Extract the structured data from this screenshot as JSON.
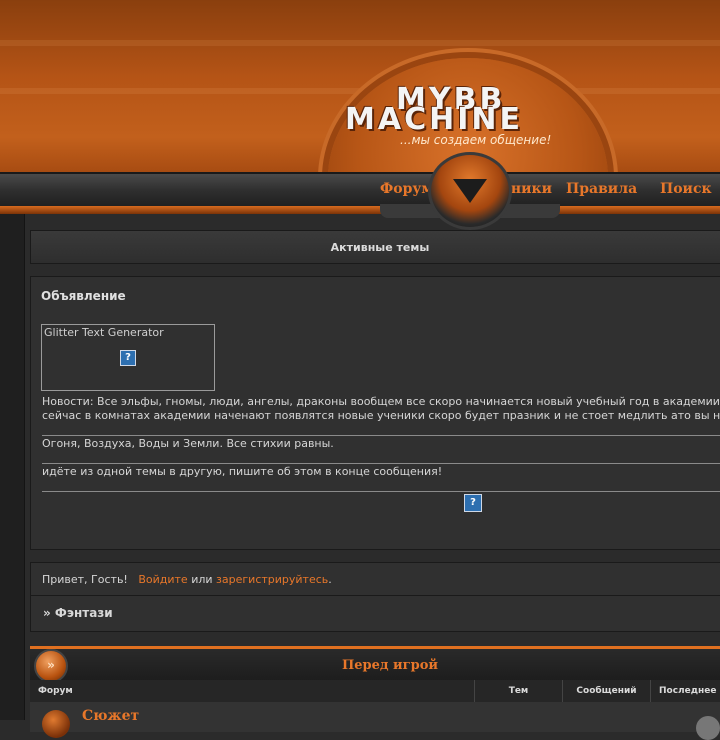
{
  "header": {
    "logo_line1": "MYBB",
    "logo_line2": "MACHINE",
    "tagline": "...мы создаем общение!"
  },
  "nav": {
    "items": [
      {
        "label": "Форум"
      },
      {
        "label": "Участники"
      },
      {
        "label": "Правила"
      },
      {
        "label": "Поиск"
      }
    ]
  },
  "active_topics": {
    "label": "Активные темы"
  },
  "announcement": {
    "title": "Объявление",
    "glitter_label": "Glitter Text Generator",
    "image_placeholder": "?",
    "line1": "Новости: Все эльфы, гномы, люди, ангелы, драконы вообщем все скоро начинается новый учебный год в академии",
    "line2": "сейчас в комнатах академии наченают появлятся новые ученики скоро будет празник и не стоет медлить ато вы н",
    "line3": "Огоня, Воздуха, Воды и Земли. Все стихии равны.",
    "line4": "идёте из одной темы в другую, пишите об этом в конце сообщения!"
  },
  "welcome": {
    "greeting": "Привет, Гость!",
    "login": "Войдите",
    "or": "или",
    "register": "зарегистрируйтесь",
    "period": "."
  },
  "breadcrumb": {
    "text": "» Фэнтази"
  },
  "category": {
    "title": "Перед игрой",
    "columns": [
      "Форум",
      "Тем",
      "Сообщений",
      "Последнее с"
    ],
    "forums": [
      {
        "name": "Сюжет"
      }
    ]
  },
  "colors": {
    "accent": "#e8772a",
    "header_orange": "#b55416",
    "panel": "#303030"
  }
}
